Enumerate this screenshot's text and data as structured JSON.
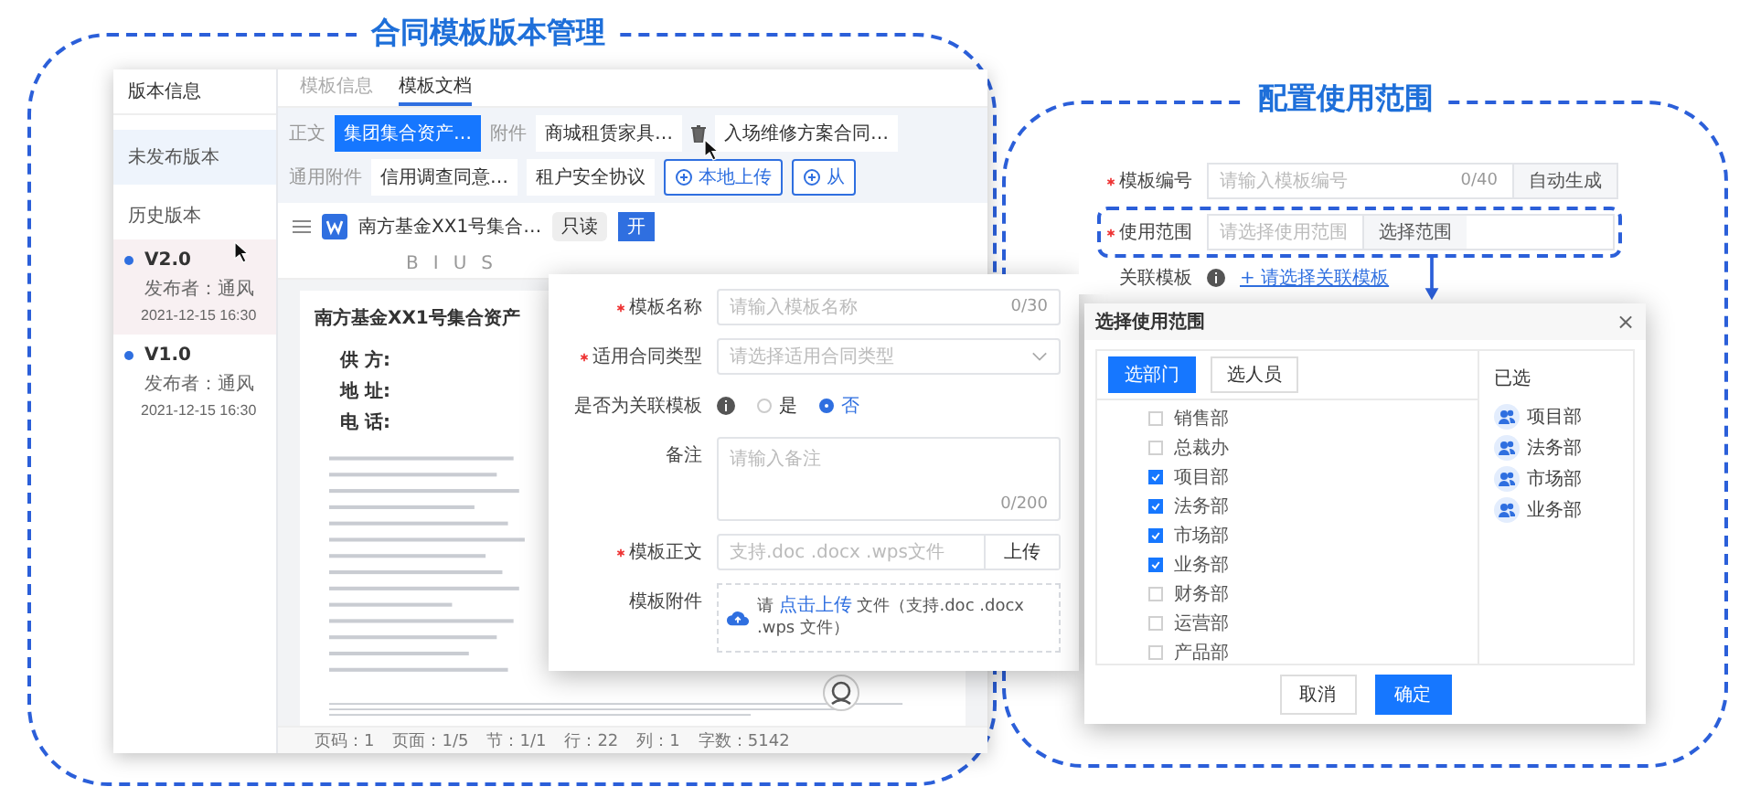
{
  "version_manager": {
    "title": "合同模板版本管理",
    "sidebar": {
      "header": "版本信息",
      "unpublished": "未发布版本",
      "history_label": "历史版本",
      "versions": [
        {
          "name": "V2.0",
          "publisher": "发布者：通风",
          "time": "2021-12-15  16:30",
          "selected": true
        },
        {
          "name": "V1.0",
          "publisher": "发布者：通风",
          "time": "2021-12-15  16:30",
          "selected": false
        }
      ]
    },
    "tabs": [
      {
        "label": "模板信息",
        "selected": false
      },
      {
        "label": "模板文档",
        "selected": true
      }
    ],
    "attachment_bar": [
      {
        "kind": "label",
        "text": "正文"
      },
      {
        "kind": "chip",
        "text": "集团集合资产…",
        "selected": true
      },
      {
        "kind": "label",
        "text": "附件"
      },
      {
        "kind": "chip",
        "text": "商城租赁家具…",
        "selected": false
      },
      {
        "kind": "handle"
      },
      {
        "kind": "chip",
        "text": "入场维修方案合同…",
        "selected": false
      },
      {
        "kind": "label",
        "text": "通用附件"
      },
      {
        "kind": "chip",
        "text": "信用调查同意…",
        "selected": false
      },
      {
        "kind": "chip",
        "text": "租户安全协议",
        "selected": false
      },
      {
        "kind": "button",
        "text": "本地上传"
      },
      {
        "kind": "button",
        "text": "从"
      }
    ],
    "document": {
      "file_name": "南方基金XX1号集合…",
      "mode_badge": "只读",
      "action": "开",
      "toolbar": [
        "B",
        "I",
        "U",
        "S"
      ],
      "page": {
        "title": "南方基金XX1号集合资产",
        "fields": [
          "供 方:",
          "地 址:",
          "电 话:"
        ]
      }
    },
    "status_bar": [
      "页码：1",
      "页面：1/5",
      "节：1/1",
      "行：22",
      "列：1",
      "字数：5142"
    ]
  },
  "template_form": {
    "fields": [
      {
        "kind": "input",
        "label": "模板名称",
        "required": true,
        "placeholder": "请输入模板名称",
        "counter": "0/30"
      },
      {
        "kind": "select",
        "label": "适用合同类型",
        "required": true,
        "placeholder": "请选择适用合同类型"
      },
      {
        "kind": "radio",
        "label": "是否为关联模板",
        "required": false,
        "options": [
          {
            "label": "是",
            "selected": false
          },
          {
            "label": "否",
            "selected": true
          }
        ]
      },
      {
        "kind": "textarea",
        "label": "备注",
        "required": false,
        "placeholder": "请输入备注",
        "counter": "0/200"
      },
      {
        "kind": "file",
        "label": "模板正文",
        "required": true,
        "placeholder": "支持.doc .docx .wps文件",
        "button": "上传"
      },
      {
        "kind": "upload",
        "label": "模板附件",
        "required": false,
        "prefix": "请",
        "link": "点击上传",
        "hint": "文件（支持.doc .docx .wps 文件）"
      }
    ]
  },
  "scope_config": {
    "title": "配置使用范围",
    "fields": [
      {
        "kind": "addon",
        "label": "模板编号",
        "required": true,
        "placeholder": "请输入模板编号",
        "counter": "0/40",
        "button": "自动生成",
        "highlighted": false
      },
      {
        "kind": "addon",
        "label": "使用范围",
        "required": true,
        "placeholder": "请选择使用范围",
        "button": "选择范围",
        "highlighted": true
      },
      {
        "kind": "link",
        "label": "关联模板",
        "required": false,
        "link": "+ 请选择关联模板",
        "highlighted": false
      }
    ]
  },
  "scope_dialog": {
    "title": "选择使用范围",
    "close": "×",
    "tabs": [
      {
        "label": "选部门",
        "selected": true
      },
      {
        "label": "选人员",
        "selected": false
      }
    ],
    "departments": [
      {
        "name": "销售部",
        "checked": false
      },
      {
        "name": "总裁办",
        "checked": false
      },
      {
        "name": "项目部",
        "checked": true
      },
      {
        "name": "法务部",
        "checked": true
      },
      {
        "name": "市场部",
        "checked": true
      },
      {
        "name": "业务部",
        "checked": true
      },
      {
        "name": "财务部",
        "checked": false
      },
      {
        "name": "运营部",
        "checked": false
      },
      {
        "name": "产品部",
        "checked": false
      }
    ],
    "selected_label": "已选",
    "selected_items": [
      "项目部",
      "法务部",
      "市场部",
      "业务部"
    ],
    "buttons": [
      {
        "label": "取消",
        "kind": "default"
      },
      {
        "label": "确定",
        "kind": "primary"
      }
    ]
  }
}
